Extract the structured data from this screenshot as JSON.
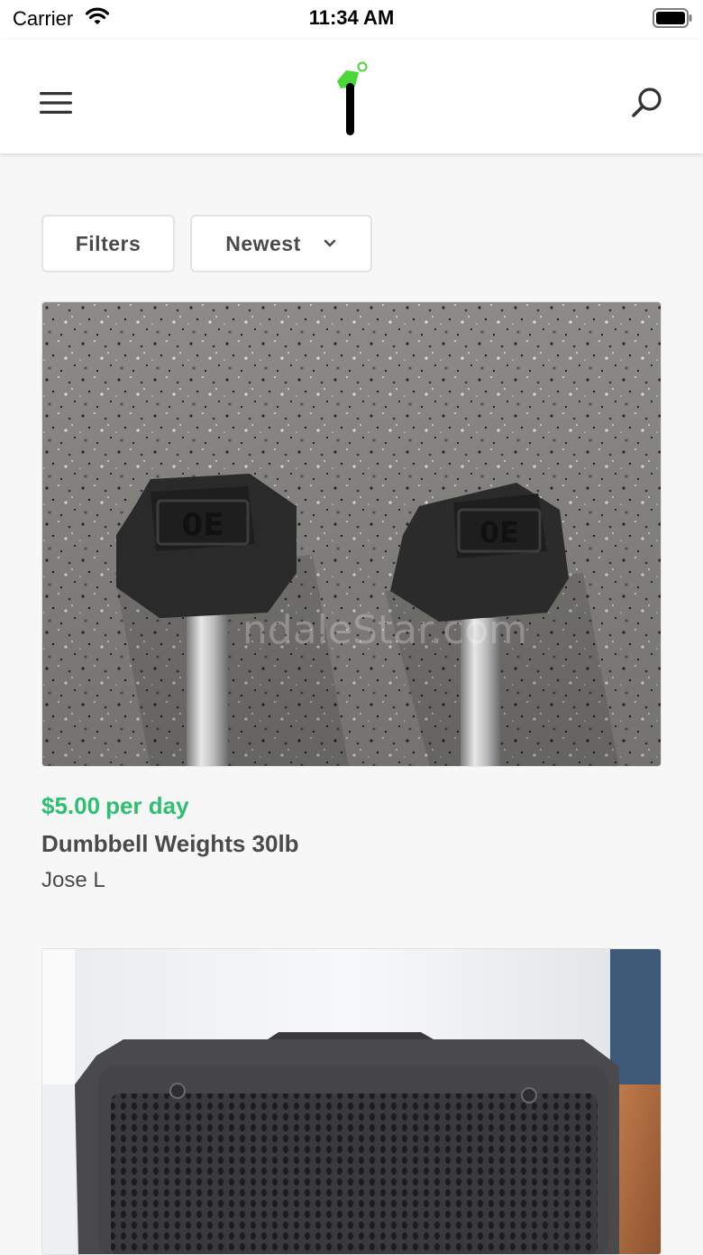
{
  "status_bar": {
    "carrier": "Carrier",
    "time": "11:34 AM"
  },
  "nav": {
    "menu_icon": "hamburger-menu-icon",
    "logo_icon": "app-logo-icon",
    "search_icon": "search-icon"
  },
  "filters": {
    "filters_label": "Filters",
    "sort_label": "Newest"
  },
  "listings": [
    {
      "image": "dumbbells-photo",
      "watermark": "ndaleStar.com",
      "price": "$5.00",
      "price_suffix": "per day",
      "title": "Dumbbell Weights 30lb",
      "owner": "Jose L"
    },
    {
      "image": "speaker-photo"
    }
  ],
  "colors": {
    "accent_green": "#2fbf71",
    "text": "#4a4a4a",
    "background": "#f7f7f7"
  }
}
